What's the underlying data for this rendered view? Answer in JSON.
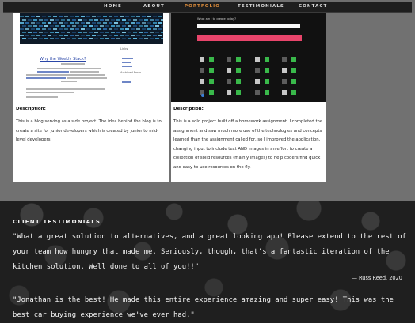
{
  "nav": {
    "items": [
      "HOME",
      "ABOUT",
      "PORTFOLIO",
      "TESTIMONIALS",
      "CONTACT"
    ],
    "active": "PORTFOLIO"
  },
  "portfolio": {
    "cards": [
      {
        "description_label": "Description:",
        "description": "This is a blog serving as a side project. The idea behind the blog is to create a site for junior developers which is created by junior to mid-level developers.",
        "thumb": {
          "heading": "Why the Weekly Stack?",
          "side_title": "Links",
          "side_title_2": "Archived Posts"
        }
      },
      {
        "description_label": "Description:",
        "description": "This is a solo project built off a homework assignment. I completed the assignment and saw much more use of the technologies and concepts learned than the assignment called for, so I improved the application, changing input to include text AND images in an effort to create a collection of solid resources (mainly images) to help coders find quick and easy-to-use resources on the fly.",
        "thumb": {
          "question": "What am i to create today?"
        }
      }
    ]
  },
  "testimonials": {
    "title": "CLIENT TESTIMONIALS",
    "quotes": [
      {
        "text": "\"What a great solution to alternatives, and a great looking app! Please extend to the rest of your team how hungry that made me. Seriously, though, that's a fantastic iteration of the kitchen solution. Well done to all of you!!\"",
        "author": "— Russ Reed, 2020"
      },
      {
        "text": "\"Jonathan is the best! He made this entire experience amazing and super easy! This was the best car buying experience we've ever had.\""
      }
    ]
  },
  "colors": {
    "nav_bg": "#1e1e1e",
    "nav_active": "#d98a3a",
    "accent_pink": "#e8456b",
    "tile_green": "#39b84a"
  }
}
